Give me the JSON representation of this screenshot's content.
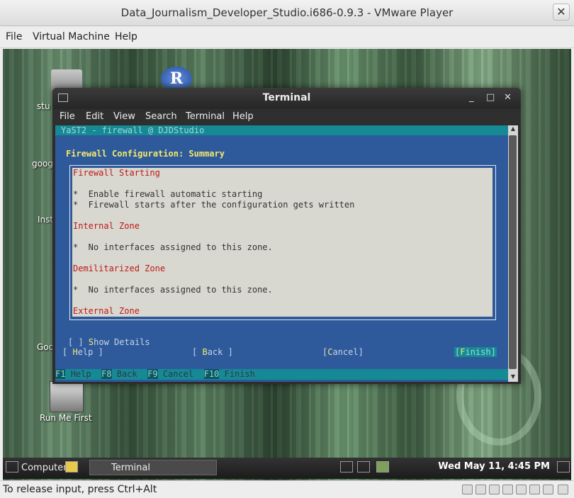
{
  "vmware": {
    "title": "Data_Journalism_Developer_Studio.i686-0.9.3 - VMware Player",
    "close_glyph": "✕",
    "menu": [
      "File",
      "Virtual Machine",
      "Help"
    ],
    "status_text": "To release input, press Ctrl+Alt"
  },
  "desktop": {
    "icons": [
      {
        "label": "stu",
        "icon": "folder-icon"
      },
      {
        "label": "R",
        "icon": "r-logo-icon"
      },
      {
        "label": "goog",
        "icon": "file-icon"
      },
      {
        "label": "Inst",
        "icon": "file-icon"
      },
      {
        "label": "Goo",
        "icon": "file-icon"
      },
      {
        "label": "Run Me First",
        "icon": "chess-icon"
      }
    ]
  },
  "terminal": {
    "title": "Terminal",
    "controls": {
      "minimize": "_",
      "maximize": "□",
      "close": "✕"
    },
    "menu": [
      "File",
      "Edit",
      "View",
      "Search",
      "Terminal",
      "Help"
    ]
  },
  "yast": {
    "header": "YaST2 - firewall @ DJDStudio",
    "heading": "Firewall Configuration: Summary",
    "summary": {
      "section1_title": "Firewall Starting",
      "bullet1_prefix": "*  ",
      "bullet1_enable": "Enable",
      "bullet1_rest": " firewall automatic starting",
      "bullet2": "*  Firewall starts after the configuration gets written",
      "section2_title": "Internal Zone",
      "section2_bullet": "*  No interfaces assigned to this zone.",
      "section3_title": "Demilitarized Zone",
      "section3_bullet": "*  No interfaces assigned to this zone.",
      "section4_title": "External Zone"
    },
    "show_details": {
      "box": "[ ] ",
      "hot": "S",
      "rest": "how Details"
    },
    "buttons": {
      "help": {
        "pre": "[ ",
        "hot": "H",
        "rest": "elp ]"
      },
      "back": {
        "pre": "[ ",
        "hot": "B",
        "rest": "ack ]"
      },
      "cancel": {
        "pre": "[",
        "hot": "C",
        "rest": "ancel]"
      },
      "finish": {
        "pre": "[",
        "hot": "F",
        "rest": "inish]"
      }
    },
    "fkeys": [
      {
        "key": "F1",
        "label": "Help"
      },
      {
        "key": "F8",
        "label": "Back"
      },
      {
        "key": "F9",
        "label": "Cancel"
      },
      {
        "key": "F10",
        "label": "Finish"
      }
    ]
  },
  "taskbar": {
    "computer_label": "Computer",
    "task_label": "Terminal",
    "clock": "Wed May 11,  4:45 PM"
  }
}
